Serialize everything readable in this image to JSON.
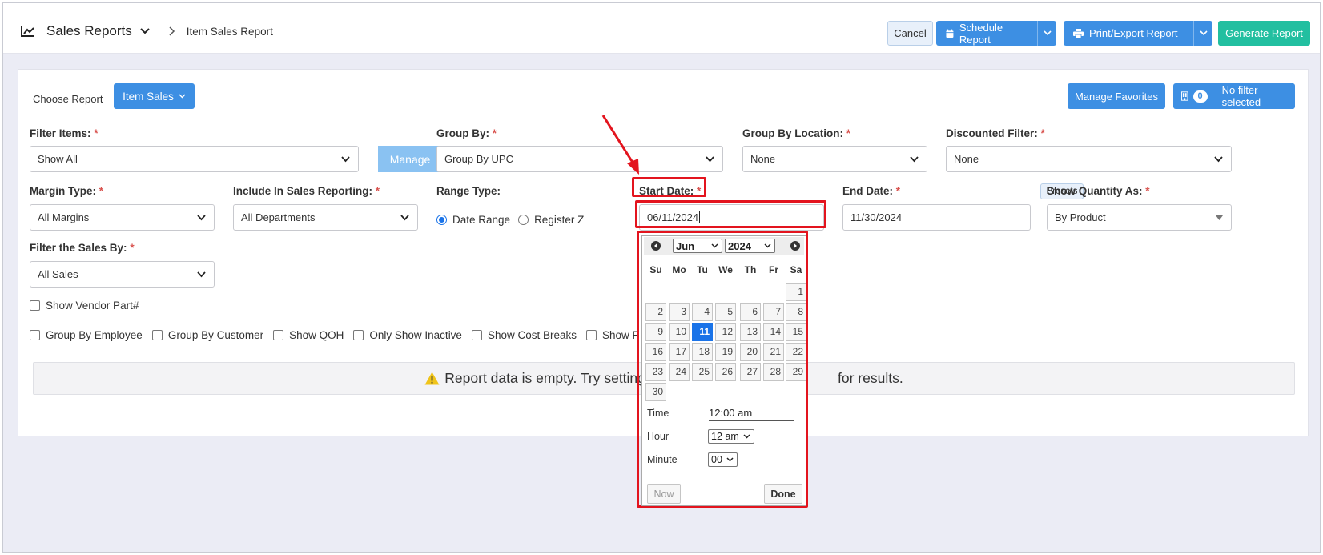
{
  "header": {
    "title": "Sales Reports",
    "breadcrumb": "Item Sales Report",
    "cancel_label": "Cancel",
    "schedule_label": "Schedule Report",
    "print_label": "Print/Export Report",
    "generate_label": "Generate Report"
  },
  "panel": {
    "choose_label": "Choose Report",
    "report_button": "Item Sales",
    "favorites_button": "Manage Favorites",
    "filter_count": "0",
    "filter_status": "No filter selected"
  },
  "form": {
    "filter_items": {
      "label": "Filter Items:",
      "value": "Show All",
      "manage": "Manage"
    },
    "group_by": {
      "label": "Group By:",
      "value": "Group By UPC"
    },
    "group_by_location": {
      "label": "Group By Location:",
      "value": "None"
    },
    "discounted_filter": {
      "label": "Discounted Filter:",
      "value": "None"
    },
    "margin_type": {
      "label": "Margin Type:",
      "value": "All Margins"
    },
    "include_sales": {
      "label": "Include In Sales Reporting:",
      "value": "All Departments"
    },
    "range_type": {
      "label": "Range Type:",
      "option1": "Date Range",
      "option2": "Register Z"
    },
    "start_date": {
      "label": "Start Date:",
      "value": "06/11/2024"
    },
    "end_date": {
      "label": "End Date:",
      "value": "11/30/2024",
      "presets": "Presets"
    },
    "show_quantity": {
      "label": "Show Quantity As:",
      "value": "By Product"
    },
    "filter_sales_by": {
      "label": "Filter the Sales By:",
      "value": "All Sales"
    },
    "required_mark": "*"
  },
  "checkboxes": {
    "vendor_part": "Show Vendor Part#",
    "group_employee": "Group By Employee",
    "group_customer": "Group By Customer",
    "show_qoh": "Show QOH",
    "only_inactive": "Only Show Inactive",
    "cost_breaks": "Show Cost Breaks",
    "price_breaks": "Show Price Br"
  },
  "notice": {
    "text": "Report data is empty. Try setting filte",
    "text_end": "for results."
  },
  "calendar": {
    "month": "Jun",
    "year": "2024",
    "weekdays": [
      "Su",
      "Mo",
      "Tu",
      "We",
      "Th",
      "Fr",
      "Sa"
    ],
    "days": [
      "1",
      "2",
      "3",
      "4",
      "5",
      "6",
      "7",
      "8",
      "9",
      "10",
      "11",
      "12",
      "13",
      "14",
      "15",
      "16",
      "17",
      "18",
      "19",
      "20",
      "21",
      "22",
      "23",
      "24",
      "25",
      "26",
      "27",
      "28",
      "29",
      "30"
    ],
    "selected_day": "11",
    "time_label": "Time",
    "time_value": "12:00 am",
    "hour_label": "Hour",
    "hour_value": "12 am",
    "minute_label": "Minute",
    "minute_value": "00",
    "now_label": "Now",
    "done_label": "Done"
  },
  "colors": {
    "primary": "#3d8fe3",
    "success": "#22bfa0",
    "highlight": "#e3141e",
    "selected_day": "#1a73e8"
  }
}
